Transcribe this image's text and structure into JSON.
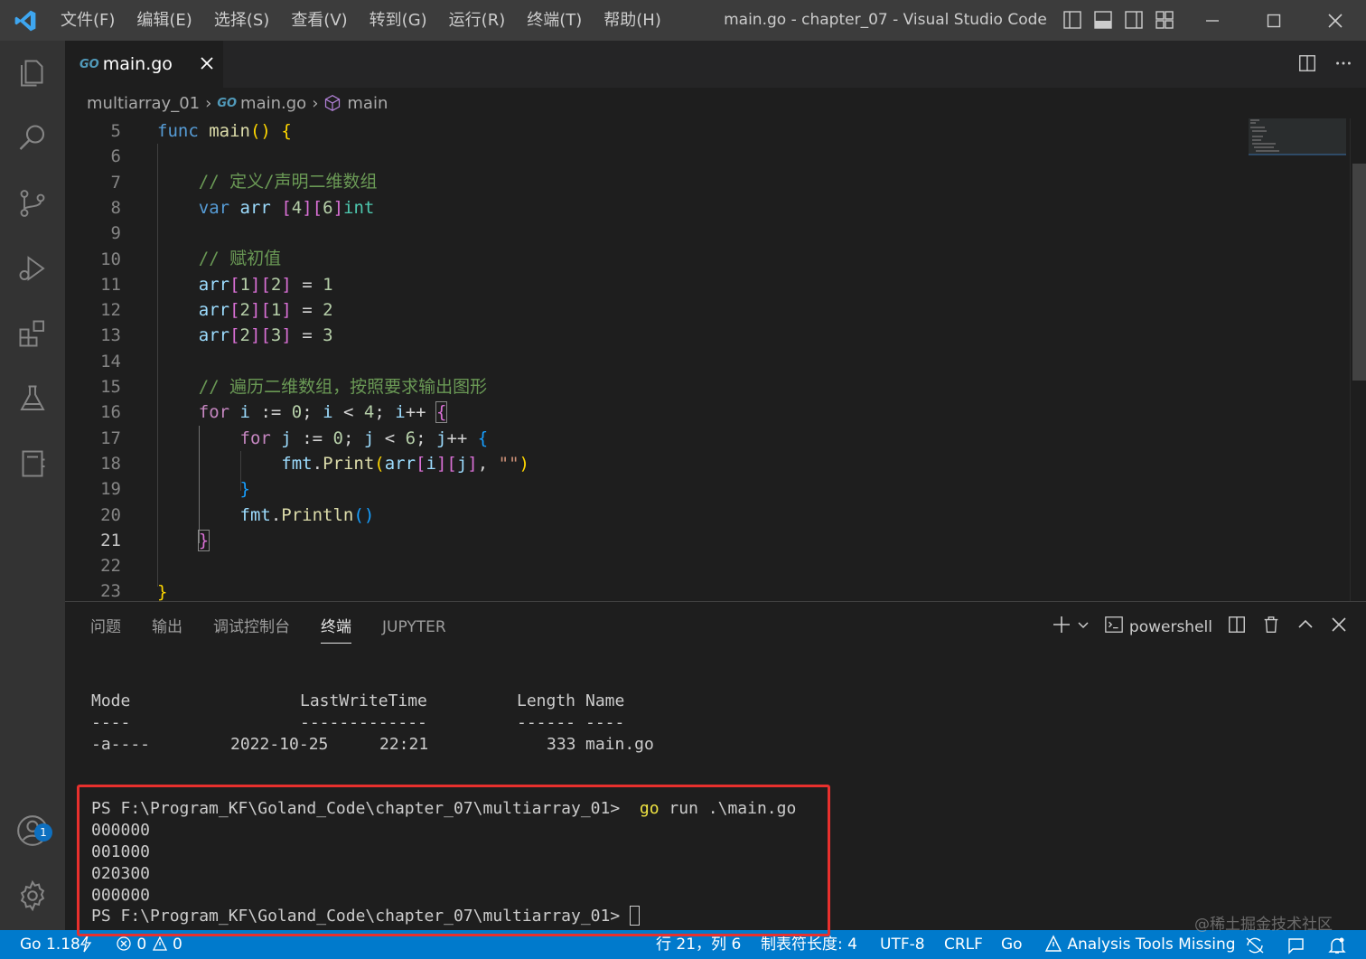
{
  "window": {
    "title": "main.go - chapter_07 - Visual Studio Code",
    "menu": [
      "文件(F)",
      "编辑(E)",
      "选择(S)",
      "查看(V)",
      "转到(G)",
      "运行(R)",
      "终端(T)",
      "帮助(H)"
    ]
  },
  "activity_bar": {
    "items": [
      "explorer-icon",
      "search-icon",
      "source-control-icon",
      "run-debug-icon",
      "extensions-icon",
      "testing-icon",
      "notebook-icon"
    ],
    "account_badge": "1"
  },
  "tab": {
    "icon_text": "GO",
    "label": "main.go"
  },
  "breadcrumb": {
    "folder": "multiarray_01",
    "file_icon_text": "GO",
    "file": "main.go",
    "symbol": "main"
  },
  "editor": {
    "line_numbers": [
      "5",
      "6",
      "7",
      "8",
      "9",
      "10",
      "11",
      "12",
      "13",
      "14",
      "15",
      "16",
      "17",
      "18",
      "19",
      "20",
      "21",
      "22",
      "23"
    ],
    "active_line": "21"
  },
  "panel": {
    "tabs": [
      "问题",
      "输出",
      "调试控制台",
      "终端",
      "JUPYTER"
    ],
    "active_tab": "终端",
    "shell": "powershell",
    "terminal": {
      "header_mode": "Mode",
      "header_time": "LastWriteTime",
      "header_length": "Length",
      "header_name": "Name",
      "sep_mode": "----",
      "sep_time": "-------------",
      "sep_length": "------",
      "sep_name": "----",
      "row_mode": "-a----",
      "row_date": "2022-10-25",
      "row_time": "22:21",
      "row_length": "333",
      "row_name": "main.go",
      "prompt": "PS F:\\Program_KF\\Goland_Code\\chapter_07\\multiarray_01>",
      "cmd_go": "go",
      "cmd_rest": "run .\\main.go",
      "output": [
        "000000",
        "001000",
        "020300",
        "000000"
      ]
    }
  },
  "status_bar": {
    "go_version": "Go 1.18",
    "errors": "0",
    "warnings": "0",
    "cursor": "行 21，列 6",
    "indent": "制表符长度: 4",
    "encoding": "UTF-8",
    "eol": "CRLF",
    "language": "Go",
    "analysis": "Analysis Tools Missing"
  },
  "watermark": "@稀土掘金技术社区",
  "colors": {
    "status_bar": "#007acc",
    "highlight_box": "#e8302d",
    "activity_bar": "#333333",
    "title_bar": "#3c3c3c"
  }
}
